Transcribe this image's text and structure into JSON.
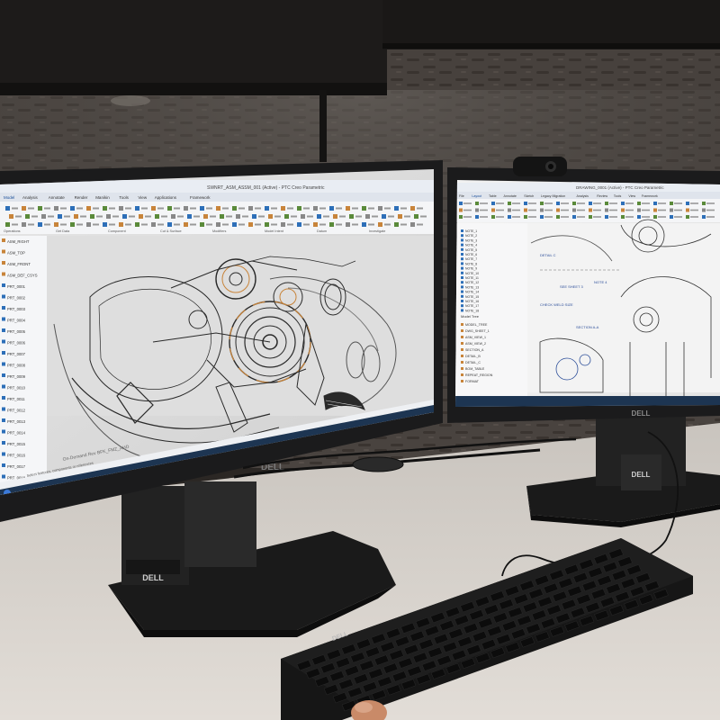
{
  "scene": {
    "description_free": true,
    "colors": {
      "wall_fabric": "#4a4440",
      "wall_dark": "#2b2724",
      "desk": "#d9d4ce",
      "monitor_bezel": "#1b1b1c",
      "cad_background": "#dcdcdc",
      "cad_lines": "#2a2a2a",
      "accent_orange": "#c8843a",
      "ribbon_blue": "#2d6fb8",
      "taskbar": "#1d3552"
    }
  },
  "left_monitor": {
    "brand": "DELL",
    "stand_brand": "DELL",
    "window_title": "SWNRT_ASM_ASSM_001 (Active) - PTC Creo Parametric",
    "ribbon_tabs": [
      "Model",
      "Analysis",
      "Annotate",
      "Render",
      "Manikin",
      "Tools",
      "View",
      "Applications",
      "Framework"
    ],
    "ribbon_groups": [
      "Operations",
      "Get Data",
      "Component",
      "Cut & Surface",
      "Modifiers",
      "Model Intent",
      "Datum",
      "Investigate"
    ],
    "tree_items": [
      "ASM_RIGHT",
      "ASM_TOP",
      "ASM_FRONT",
      "ASM_DEF_CSYS",
      "PRT_0001",
      "PRT_0002",
      "PRT_0003",
      "PRT_0004",
      "PRT_0005",
      "PRT_0006",
      "PRT_0007",
      "PRT_0008",
      "PRT_0009",
      "PRT_0010",
      "PRT_0011",
      "PRT_0012",
      "PRT_0013",
      "PRT_0014",
      "PRT_0015",
      "PRT_0016",
      "PRT_0017",
      "PRT_0018"
    ],
    "status_text": "On-Demand Rev BFK_FMZ_AHD",
    "message_text": "Select features, components or references"
  },
  "right_monitor": {
    "brand": "DELL",
    "stand_brand": "DELL",
    "window_title": "DRAWING_0001 (Active) - PTC Creo Parametric",
    "ribbon_tabs": [
      "File",
      "Layout",
      "Table",
      "Annotate",
      "Sketch",
      "Legacy Migration",
      "Analysis",
      "Review",
      "Tools",
      "View",
      "Framework"
    ],
    "tree_items": [
      "NOTE_1",
      "NOTE_2",
      "NOTE_3",
      "NOTE_4",
      "NOTE_5",
      "NOTE_6",
      "NOTE_7",
      "NOTE_8",
      "NOTE_9",
      "NOTE_10",
      "NOTE_11",
      "NOTE_12",
      "NOTE_13",
      "NOTE_14",
      "NOTE_15",
      "NOTE_16",
      "NOTE_17",
      "NOTE_18"
    ],
    "lower_tree_items": [
      "MODEL_TREE",
      "DWG_SHEET_1",
      "ASM_VIEW_1",
      "ASM_VIEW_2",
      "SECTION_A",
      "DETAIL_B",
      "DETAIL_C",
      "BOM_TABLE",
      "REPEAT_REGION",
      "FORMAT"
    ],
    "tree_label": "Model Tree",
    "drawing_notes": [
      "DETAIL C",
      "SEE SHEET 3",
      "CHECK WELD SIZE",
      "NOTE 4",
      "SECTION A-A"
    ]
  },
  "keyboard": {
    "brand": "DELL"
  },
  "webcam": {
    "present": true
  }
}
